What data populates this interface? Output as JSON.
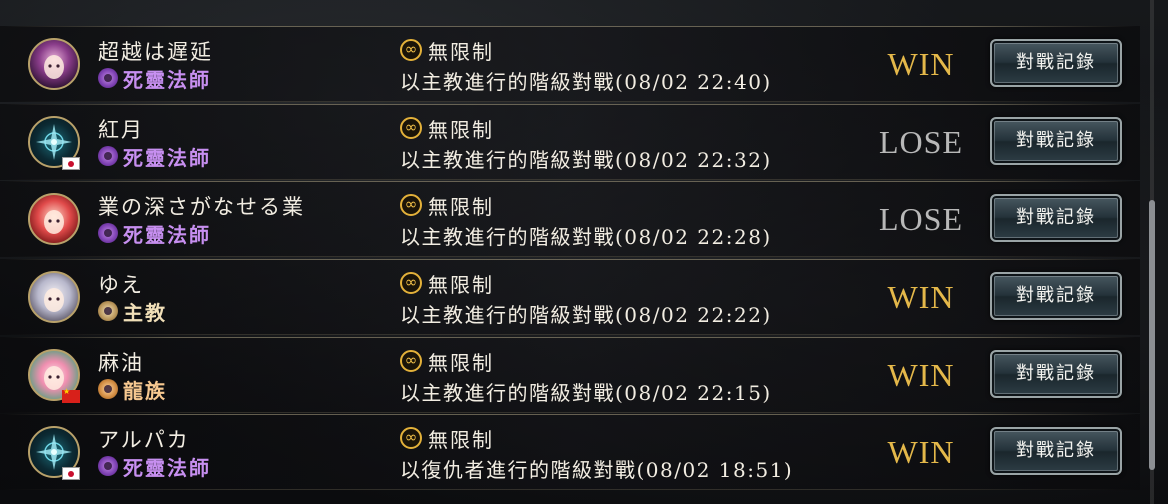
{
  "replay_label": "對戰記錄",
  "matches": [
    {
      "opponent": "超越は遅延",
      "class": "死靈法師",
      "class_icon": "necromancer-icon",
      "avatar": "girl1",
      "flag": null,
      "format": "無限制",
      "description": "以主教進行的階級對戰(08/02 22:40)",
      "result": "WIN"
    },
    {
      "opponent": "紅月",
      "class": "死靈法師",
      "class_icon": "necromancer-icon",
      "avatar": "emblem",
      "flag": "jp",
      "format": "無限制",
      "description": "以主教進行的階級對戰(08/02 22:32)",
      "result": "LOSE"
    },
    {
      "opponent": "業の深さがなせる業",
      "class": "死靈法師",
      "class_icon": "necromancer-icon",
      "avatar": "girl2",
      "flag": null,
      "format": "無限制",
      "description": "以主教進行的階級對戰(08/02 22:28)",
      "result": "LOSE"
    },
    {
      "opponent": "ゆえ",
      "class": "主教",
      "class_icon": "bishop-icon",
      "avatar": "girl3",
      "flag": null,
      "format": "無限制",
      "description": "以主教進行的階級對戰(08/02 22:22)",
      "result": "WIN"
    },
    {
      "opponent": "麻油",
      "class": "龍族",
      "class_icon": "dragoncraft-icon",
      "avatar": "girl4",
      "flag": "cn",
      "format": "無限制",
      "description": "以主教進行的階級對戰(08/02 22:15)",
      "result": "WIN"
    },
    {
      "opponent": "アルパカ",
      "class": "死靈法師",
      "class_icon": "necromancer-icon",
      "avatar": "emblem",
      "flag": "jp",
      "format": "無限制",
      "description": "以復仇者進行的階級對戰(08/02 18:51)",
      "result": "WIN"
    }
  ],
  "colors": {
    "win": "#e4b84a",
    "lose": "#b8b8b8",
    "necromancer": "#c78ff0",
    "bishop": "#f0dfb8",
    "dragoncraft": "#f6c890",
    "format_icon": "#e3b13a"
  }
}
